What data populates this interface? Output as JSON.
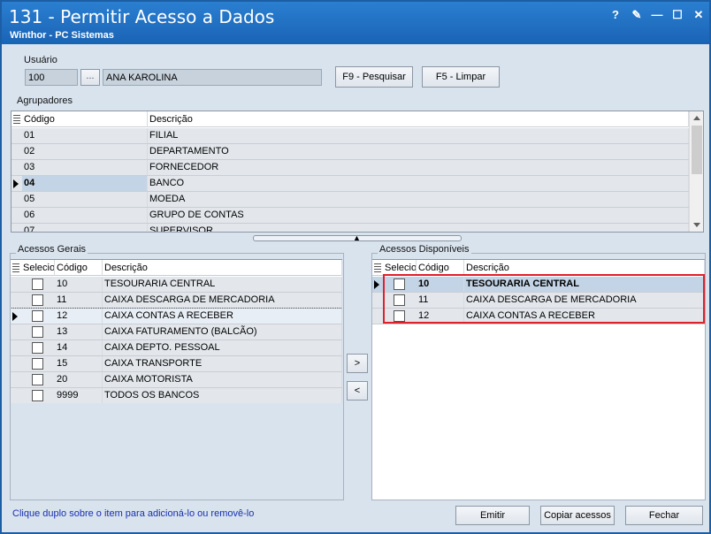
{
  "window": {
    "title": "131 - Permitir Acesso a Dados",
    "subtitle": "Winthor - PC Sistemas",
    "controls": {
      "help": "?",
      "edit": "✎",
      "minimize": "—",
      "maximize": "☐",
      "close": "✕"
    }
  },
  "usuario": {
    "label": "Usuário",
    "code": "100",
    "lookup": "...",
    "name": "ANA KAROLINA",
    "search_button": "F9 - Pesquisar",
    "clear_button": "F5 - Limpar"
  },
  "agrupadores": {
    "label": "Agrupadores",
    "columns": [
      "Código",
      "Descrição"
    ],
    "rows": [
      {
        "code": "01",
        "desc": "FILIAL"
      },
      {
        "code": "02",
        "desc": "DEPARTAMENTO"
      },
      {
        "code": "03",
        "desc": "FORNECEDOR"
      },
      {
        "code": "04",
        "desc": "BANCO"
      },
      {
        "code": "05",
        "desc": "MOEDA"
      },
      {
        "code": "06",
        "desc": "GRUPO DE CONTAS"
      },
      {
        "code": "07",
        "desc": "SUPERVISOR"
      }
    ]
  },
  "acessos_gerais": {
    "label": "Acessos Gerais",
    "columns": [
      "Selecio",
      "Código",
      "Descrição"
    ],
    "rows": [
      {
        "code": "10",
        "desc": "TESOURARIA CENTRAL"
      },
      {
        "code": "11",
        "desc": "CAIXA DESCARGA DE MERCADORIA"
      },
      {
        "code": "12",
        "desc": "CAIXA CONTAS A RECEBER"
      },
      {
        "code": "13",
        "desc": "CAIXA FATURAMENTO (BALCÃO)"
      },
      {
        "code": "14",
        "desc": "CAIXA DEPTO. PESSOAL"
      },
      {
        "code": "15",
        "desc": "CAIXA TRANSPORTE"
      },
      {
        "code": "20",
        "desc": "CAIXA MOTORISTA"
      },
      {
        "code": "9999",
        "desc": "TODOS OS BANCOS"
      }
    ]
  },
  "transfer": {
    "add": ">",
    "remove": "<"
  },
  "acessos_disponiveis": {
    "label": "Acessos Disponíveis",
    "columns": [
      "Selecio",
      "Código",
      "Descrição"
    ],
    "rows": [
      {
        "code": "10",
        "desc": "TESOURARIA CENTRAL"
      },
      {
        "code": "11",
        "desc": "CAIXA DESCARGA DE MERCADORIA"
      },
      {
        "code": "12",
        "desc": "CAIXA CONTAS A RECEBER"
      }
    ]
  },
  "footer": {
    "hint": "Clique duplo sobre o item para adicioná-lo ou removê-lo",
    "emitir": "Emitir",
    "copiar": "Copiar acessos",
    "fechar": "Fechar"
  },
  "colors": {
    "titlebar": "#1a63b5",
    "selected_row": "#c3d4e6",
    "highlight_box": "#e0202a",
    "hint_text": "#1a2fb0"
  }
}
